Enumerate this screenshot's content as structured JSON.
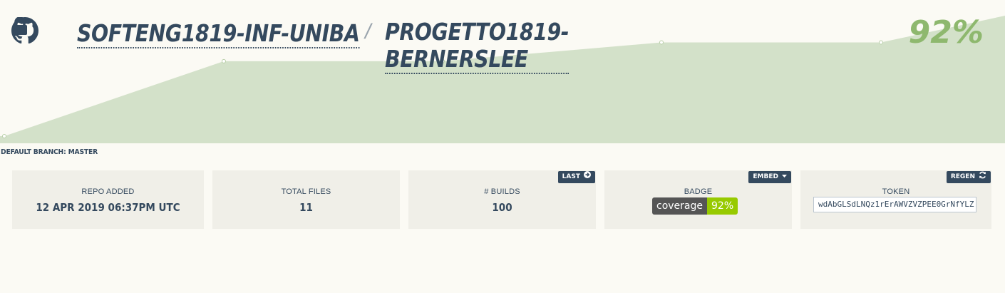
{
  "header": {
    "org": "SOFTENG1819-INF-UNIBA",
    "separator": "/",
    "repo": "PROGETTO1819-BERNERSLEE",
    "coverage": "92%",
    "icons": {
      "host": "github-icon",
      "visibility": "lock-icon"
    }
  },
  "branch": {
    "label": "DEFAULT BRANCH: MASTER"
  },
  "cards": {
    "repo_added": {
      "label": "REPO ADDED",
      "value": "12 APR 2019 06:37PM UTC"
    },
    "total_files": {
      "label": "TOTAL FILES",
      "value": "11"
    },
    "builds": {
      "label": "# BUILDS",
      "value": "100",
      "button": "LAST",
      "button_icon": "arrow-right-circle-icon"
    },
    "badge": {
      "label": "BADGE",
      "button": "EMBED",
      "button_icon": "caret-down-icon",
      "left_text": "coverage",
      "right_text": "92%"
    },
    "token": {
      "label": "TOKEN",
      "button": "REGEN",
      "button_icon": "refresh-icon",
      "value": "wdAbGLSdLNQz1rErAWVZVZPEE0GrNfYLZ"
    }
  },
  "coverage_chart": {
    "type": "area",
    "y": [
      47,
      75,
      75,
      82,
      82,
      92
    ],
    "ylim": [
      0,
      100
    ]
  },
  "colors": {
    "text": "#34495e",
    "area_fill": "#d3e1c9",
    "coverage_text": "#8eb86e",
    "badge_dark": "#555555",
    "badge_green": "#97ca00",
    "background": "#fbfaf4"
  }
}
